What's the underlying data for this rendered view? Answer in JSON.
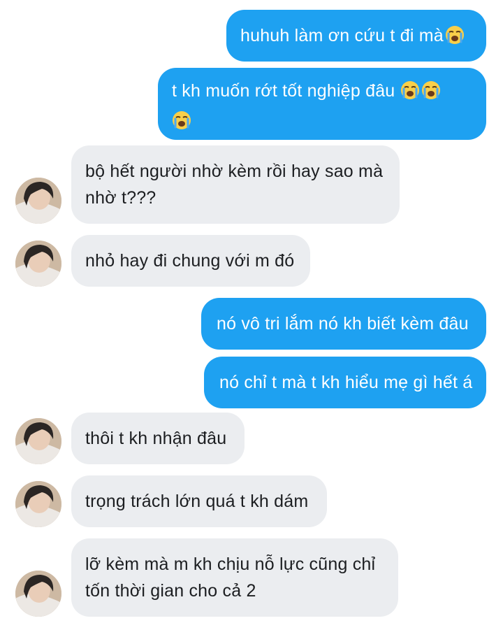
{
  "emoji": {
    "crying": "loudly-crying-face-icon"
  },
  "colors": {
    "sent_bubble": "#1ea1f1",
    "received_bubble": "#ebedf0",
    "sent_text": "#ffffff",
    "received_text": "#1c1e21"
  },
  "messages": [
    {
      "from": "me",
      "text": "huhuh làm ơn cứu t đi mà"
    },
    {
      "from": "me",
      "text": "t kh muốn rớt tốt nghiệp đâu"
    },
    {
      "from": "them",
      "line1": "bộ hết người nhờ kèm rồi hay sao mà",
      "line2": "nhờ t???"
    },
    {
      "from": "them",
      "text": "nhỏ hay đi chung với m đó"
    },
    {
      "from": "me",
      "text": "nó vô tri lắm nó kh biết kèm đâu"
    },
    {
      "from": "me",
      "text": "nó chỉ t mà t kh hiểu mẹ gì hết á"
    },
    {
      "from": "them",
      "text": "thôi t kh nhận đâu"
    },
    {
      "from": "them",
      "text": "trọng trách lớn quá t kh dám"
    },
    {
      "from": "them",
      "line1": "lỡ kèm mà m kh chịu nỗ lực cũng chỉ",
      "line2": "tốn thời gian cho cả 2"
    }
  ]
}
